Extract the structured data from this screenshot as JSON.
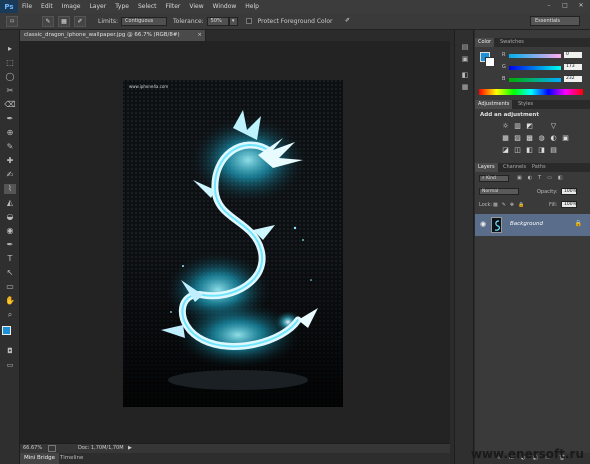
{
  "app": {
    "logo": "Ps",
    "menu": [
      "File",
      "Edit",
      "Image",
      "Layer",
      "Type",
      "Select",
      "Filter",
      "View",
      "Window",
      "Help"
    ],
    "window_controls": [
      "–",
      "□",
      "✕"
    ]
  },
  "options_bar": {
    "limits_label": "Limits:",
    "limits_value": "Contiguous",
    "tolerance_label": "Tolerance:",
    "tolerance_value": "50%",
    "protect_label": "Protect Foreground Color",
    "workspace": "Essentials"
  },
  "document": {
    "tab_title": "classic_dragon_iphone_wallpaper.jpg @ 66.7% (RGB/8#)",
    "close_glyph": "×",
    "image_caption": "www.iphone4a.com",
    "fg_color": "#1e90d6",
    "bg_color": "#ffffff"
  },
  "status": {
    "zoom": "66.67%",
    "doc_info": "Doc: 1,70M/1,70M",
    "arrow": "▶"
  },
  "bottom_tabs": [
    "Mini Bridge",
    "Timeline"
  ],
  "color_panel": {
    "tabs": [
      "Color",
      "Swatches"
    ],
    "channels": [
      {
        "letter": "R",
        "value": "0",
        "color": "#ff0000"
      },
      {
        "letter": "G",
        "value": "173",
        "color": "#00ff00"
      },
      {
        "letter": "B",
        "value": "232",
        "color": "#0000ff"
      }
    ]
  },
  "adjustments_panel": {
    "tabs": [
      "Adjustments",
      "Styles"
    ],
    "heading": "Add an adjustment",
    "row1_icons": [
      "☼",
      "▥",
      "◩",
      "▽"
    ],
    "row2_icons": [
      "▦",
      "▨",
      "▩",
      "◍",
      "◐",
      "▣"
    ],
    "row3_icons": [
      "◪",
      "◫",
      "◧",
      "◨",
      "▤"
    ]
  },
  "layers_panel": {
    "tabs": [
      "Layers",
      "Channels",
      "Paths"
    ],
    "kind_label": "Kind",
    "blend_mode": "Normal",
    "opacity_label": "Opacity:",
    "opacity_value": "100%",
    "lock_label": "Lock:",
    "fill_label": "Fill:",
    "fill_value": "100%",
    "layer_name": "Background",
    "footer_icons": [
      "∞",
      "fx",
      "◐",
      "◧",
      "▭",
      "🗑"
    ]
  },
  "toolbar": {
    "tools": [
      "▸",
      "⬚",
      "◯",
      "✂",
      "⌫",
      "✒",
      "⊕",
      "✎",
      "✚",
      "✍",
      "⌇",
      "◭",
      "◒",
      "◉",
      "✒",
      "T",
      "↖",
      "▭",
      "✋",
      "⌕"
    ]
  },
  "dock_icons": [
    "▤",
    "▣",
    "◧",
    "▦"
  ],
  "watermark": "www.enersoft.ru"
}
